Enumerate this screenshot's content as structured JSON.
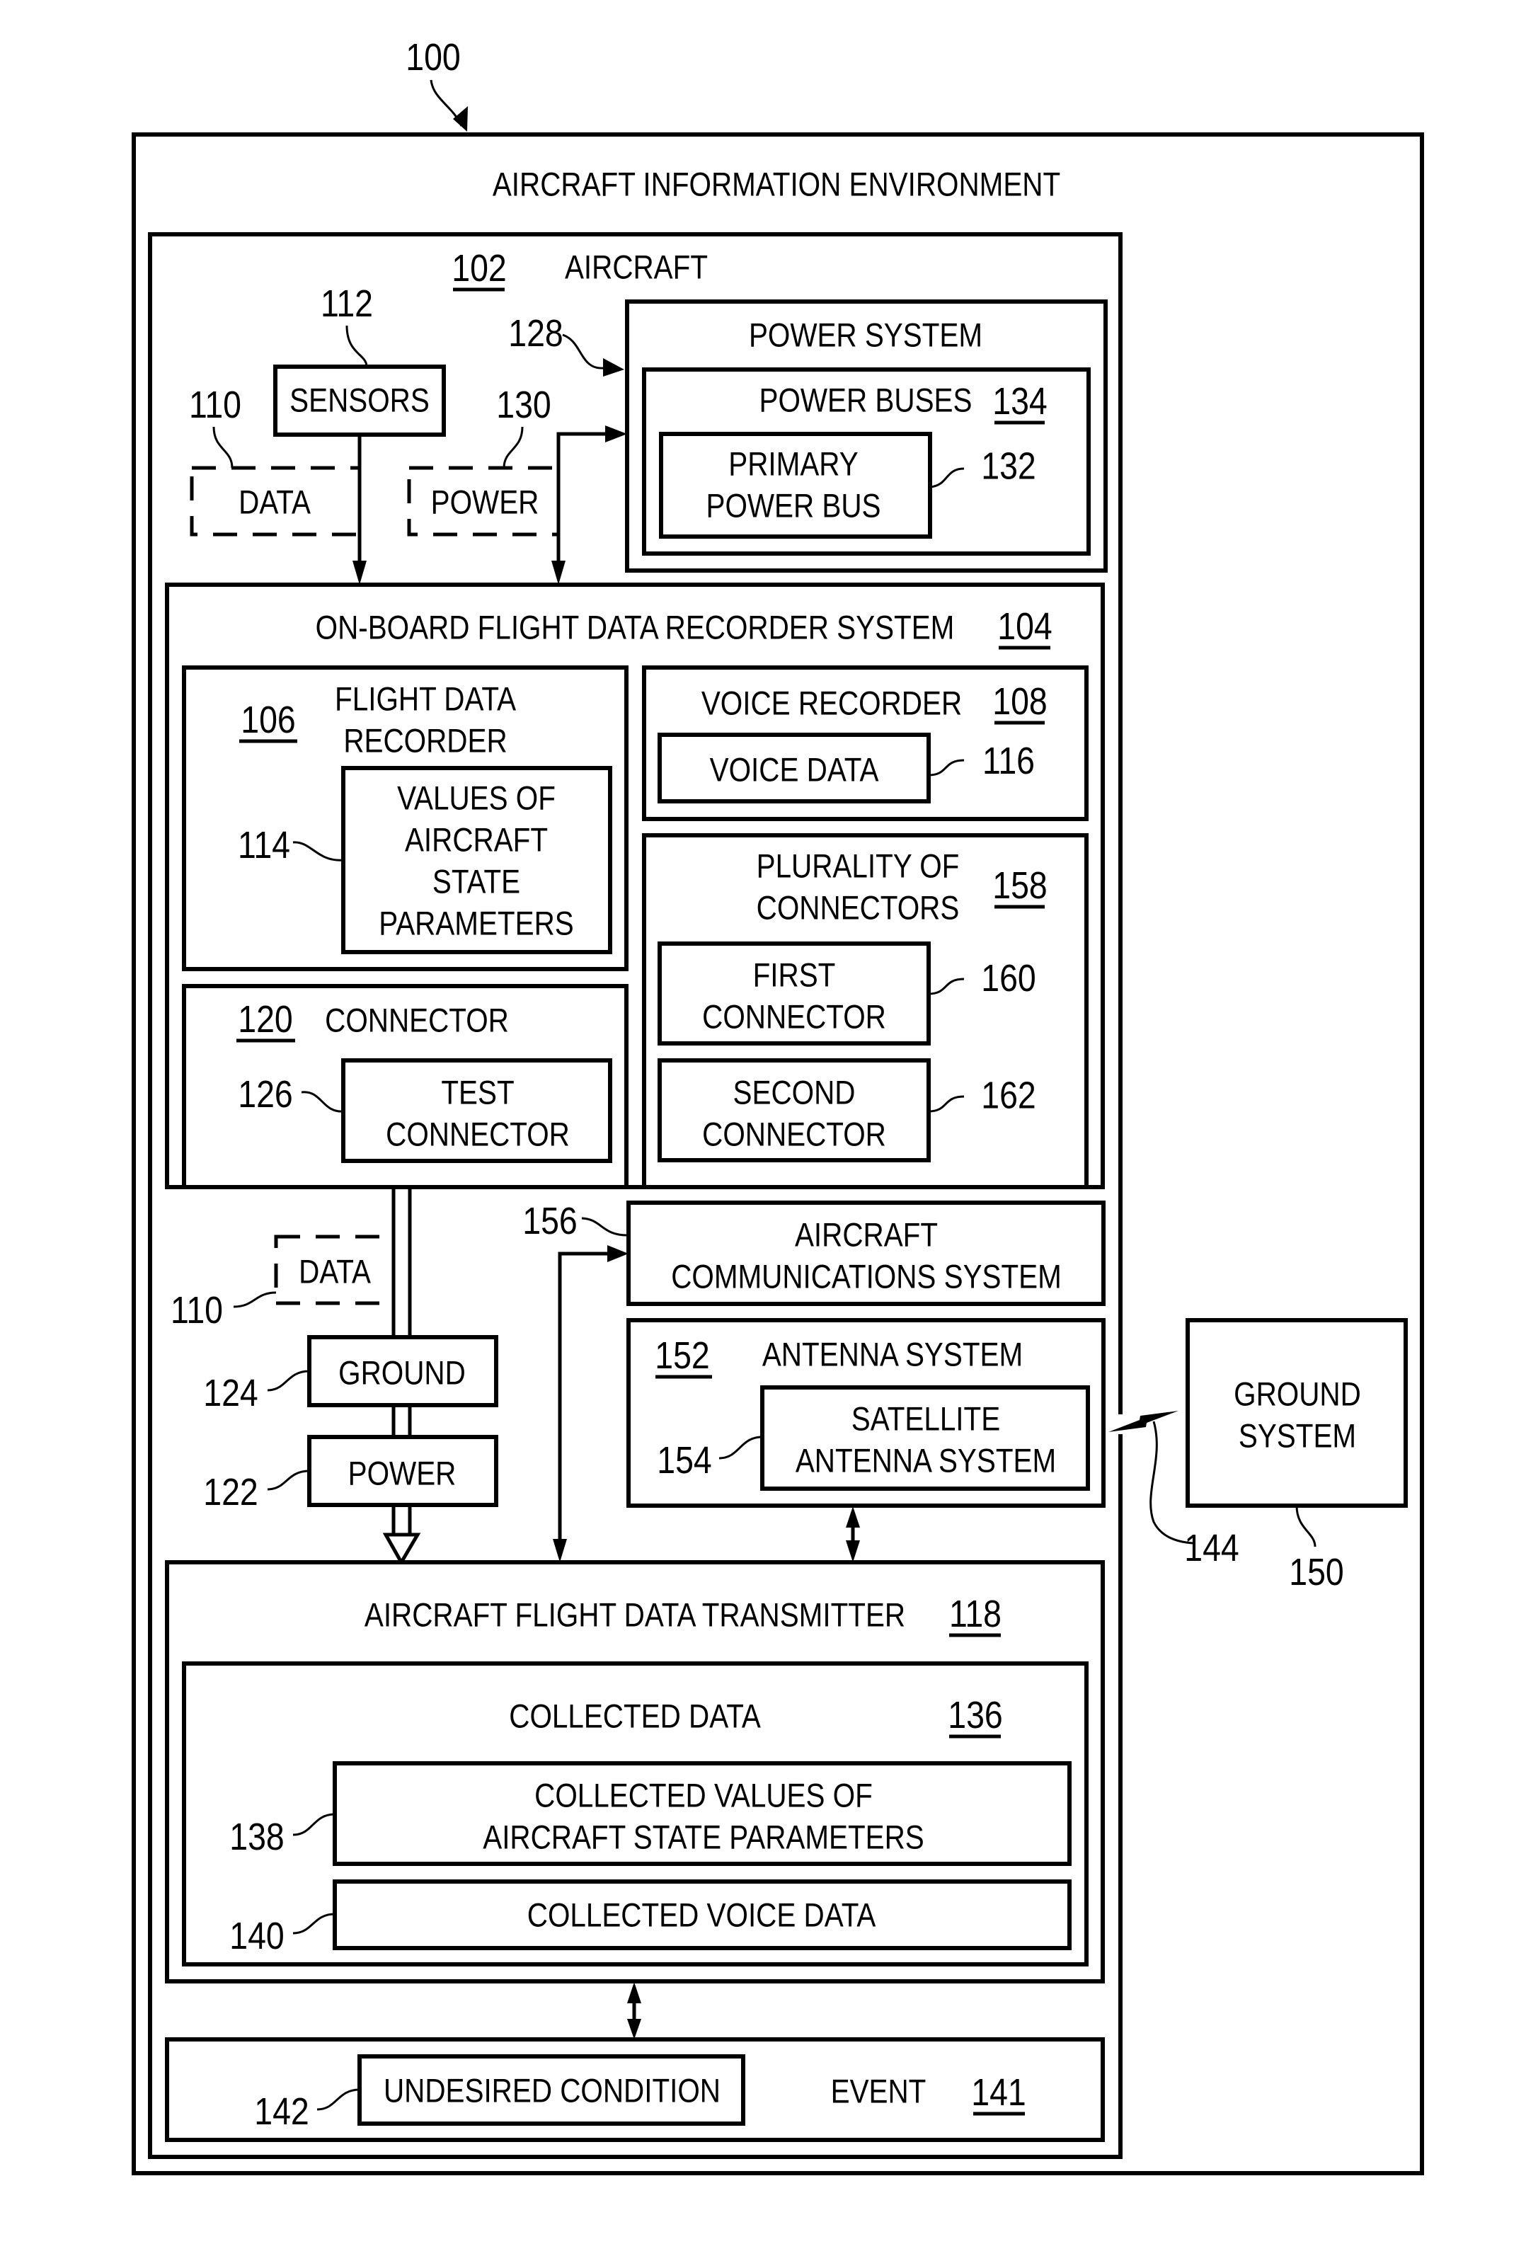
{
  "figure": {
    "ref": "100",
    "title": "AIRCRAFT INFORMATION ENVIRONMENT"
  },
  "aircraft": {
    "ref": "102",
    "label": "AIRCRAFT",
    "sensors": {
      "ref": "112",
      "label": "SENSORS"
    },
    "data_top": {
      "ref": "110",
      "label": "DATA"
    },
    "power_top": {
      "ref": "130",
      "label": "POWER"
    },
    "power_system": {
      "ref": "128",
      "label": "POWER SYSTEM",
      "power_buses": {
        "ref": "134",
        "label": "POWER BUSES"
      },
      "primary_power_bus": {
        "ref": "132",
        "lines": [
          "PRIMARY",
          "POWER BUS"
        ]
      }
    },
    "fdr_system": {
      "ref": "104",
      "label": "ON-BOARD FLIGHT DATA RECORDER SYSTEM",
      "flight_data_recorder": {
        "ref": "106",
        "lines": [
          "FLIGHT DATA",
          "RECORDER"
        ],
        "values": {
          "ref": "114",
          "lines": [
            "VALUES OF",
            "AIRCRAFT",
            "STATE",
            "PARAMETERS"
          ]
        }
      },
      "voice_recorder": {
        "ref": "108",
        "label": "VOICE RECORDER",
        "voice_data": {
          "ref": "116",
          "label": "VOICE DATA"
        }
      },
      "plurality_of_connectors": {
        "ref": "158",
        "lines": [
          "PLURALITY OF",
          "CONNECTORS"
        ],
        "first": {
          "ref": "160",
          "lines": [
            "FIRST",
            "CONNECTOR"
          ]
        },
        "second": {
          "ref": "162",
          "lines": [
            "SECOND",
            "CONNECTOR"
          ]
        }
      },
      "connector": {
        "ref": "120",
        "label": "CONNECTOR",
        "test_connector": {
          "ref": "126",
          "lines": [
            "TEST",
            "CONNECTOR"
          ]
        }
      }
    },
    "data_mid": {
      "ref": "110",
      "label": "DATA"
    },
    "ground": {
      "ref": "124",
      "label": "GROUND"
    },
    "power_mid": {
      "ref": "122",
      "label": "POWER"
    },
    "communications": {
      "ref": "156",
      "lines": [
        "AIRCRAFT",
        "COMMUNICATIONS SYSTEM"
      ]
    },
    "antenna_system": {
      "ref": "152",
      "label": "ANTENNA SYSTEM",
      "satellite": {
        "ref": "154",
        "lines": [
          "SATELLITE",
          "ANTENNA SYSTEM"
        ]
      }
    },
    "transmitter": {
      "ref": "118",
      "label": "AIRCRAFT FLIGHT DATA TRANSMITTER",
      "collected_data": {
        "ref": "136",
        "label": "COLLECTED DATA",
        "values": {
          "ref": "138",
          "lines": [
            "COLLECTED VALUES OF",
            "AIRCRAFT STATE PARAMETERS"
          ]
        },
        "voice": {
          "ref": "140",
          "label": "COLLECTED VOICE DATA"
        }
      }
    },
    "event": {
      "ref": "141",
      "label": "EVENT",
      "undesired_condition": {
        "ref": "142",
        "label": "UNDESIRED CONDITION"
      }
    }
  },
  "wireless_link": {
    "ref": "144"
  },
  "ground_system": {
    "ref": "150",
    "lines": [
      "GROUND",
      "SYSTEM"
    ]
  }
}
